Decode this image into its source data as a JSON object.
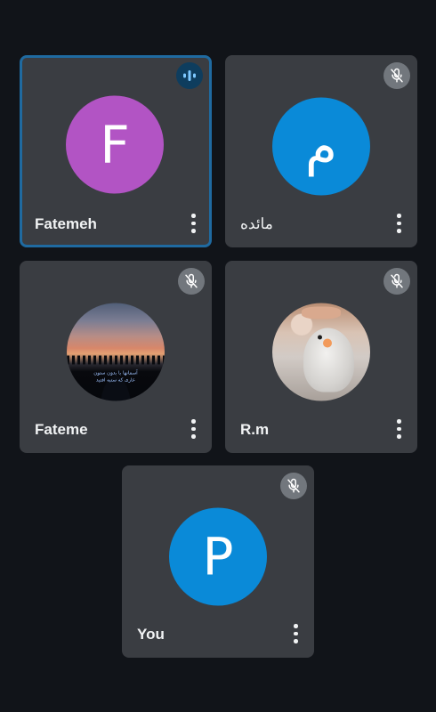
{
  "participants": [
    {
      "name": "Fatemeh",
      "avatar_letter": "F",
      "avatar_color": "#b254c4",
      "status": "speaking",
      "active": true
    },
    {
      "name": "مائده",
      "avatar_letter": "م",
      "avatar_color": "#0a8ad8",
      "status": "muted",
      "active": false
    },
    {
      "name": "Fateme",
      "avatar_letter": "",
      "avatar_color": "",
      "status": "muted",
      "active": false,
      "photo_text": "آسمانها با بدون ستون\nعاری که ستبه افتید"
    },
    {
      "name": "R.m",
      "avatar_letter": "",
      "avatar_color": "",
      "status": "muted",
      "active": false
    },
    {
      "name": "You",
      "avatar_letter": "P",
      "avatar_color": "#0a8ad8",
      "status": "muted",
      "active": false
    }
  ],
  "icons": {
    "speaking": "audio-level-icon",
    "muted": "mic-off-icon",
    "more": "more-vert-icon"
  },
  "colors": {
    "background": "#111419",
    "tile": "#3a3d42",
    "active_border": "#1f6aa0",
    "mute_badge": "#72777d",
    "speaking_badge": "#0e3d5e"
  }
}
